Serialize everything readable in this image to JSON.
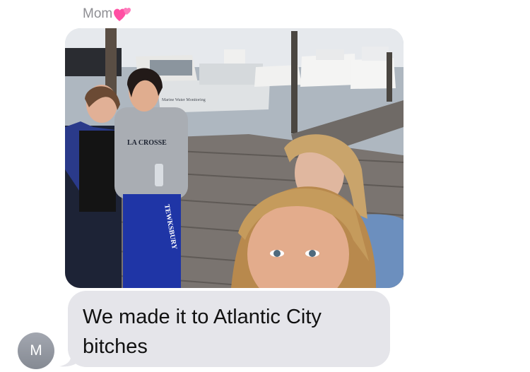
{
  "thread": {
    "sender_name": "Mom",
    "sender_emoji": "heart-emoji",
    "accent_color": "#ff5fa8"
  },
  "photo_message": {
    "printed_text": "LA CROSSE",
    "sweatpants_text": "TEWKSBURY",
    "boat_text": "Marine Water Monitoring"
  },
  "text_message": {
    "body": "We made it to Atlantic City bitches",
    "bubble_color": "#e5e5ea"
  },
  "avatar": {
    "initial": "M",
    "color": "#8e929b"
  }
}
